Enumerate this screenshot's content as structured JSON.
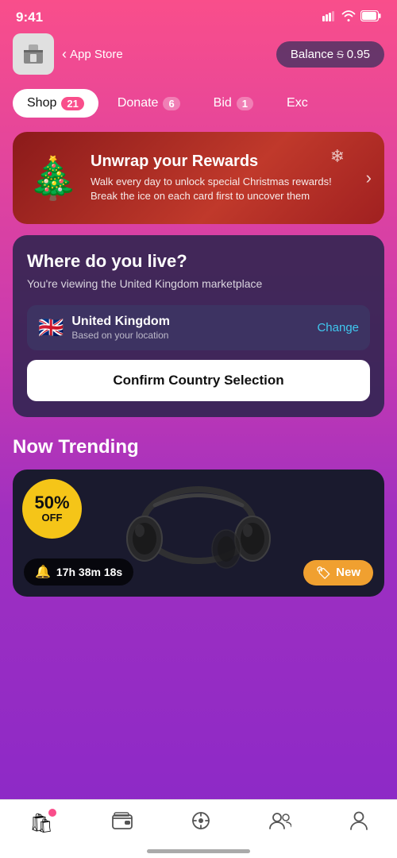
{
  "status": {
    "time": "9:41",
    "back_label": "App Store"
  },
  "balance": {
    "label": "Balance",
    "currency_symbol": "S",
    "amount": "0.95"
  },
  "tabs": [
    {
      "id": "shop",
      "label": "Shop",
      "badge": "21",
      "active": true
    },
    {
      "id": "donate",
      "label": "Donate",
      "badge": "6",
      "active": false
    },
    {
      "id": "bid",
      "label": "Bid",
      "badge": "1",
      "active": false
    },
    {
      "id": "exc",
      "label": "Exc",
      "badge": "",
      "active": false
    }
  ],
  "banner": {
    "title": "Unwrap your Rewards",
    "subtitle": "Walk every day to unlock special Christmas rewards! Break the ice on each card first to uncover them"
  },
  "location": {
    "title": "Where do you live?",
    "subtitle": "You're viewing the United Kingdom marketplace",
    "country": "United Kingdom",
    "country_desc": "Based on your location",
    "change_label": "Change",
    "confirm_label": "Confirm Country Selection"
  },
  "trending": {
    "title": "Now Trending",
    "timer": "17h 38m 18s",
    "new_label": "New",
    "sale_percent": "50%",
    "sale_off": "OFF"
  },
  "nav": {
    "items": [
      {
        "id": "shop",
        "icon": "🛍",
        "active": true,
        "dot": true
      },
      {
        "id": "wallet",
        "icon": "💳",
        "active": false,
        "dot": false
      },
      {
        "id": "explore",
        "icon": "🎯",
        "active": false,
        "dot": false
      },
      {
        "id": "community",
        "icon": "👥",
        "active": false,
        "dot": false
      },
      {
        "id": "profile",
        "icon": "👤",
        "active": false,
        "dot": false
      }
    ]
  }
}
